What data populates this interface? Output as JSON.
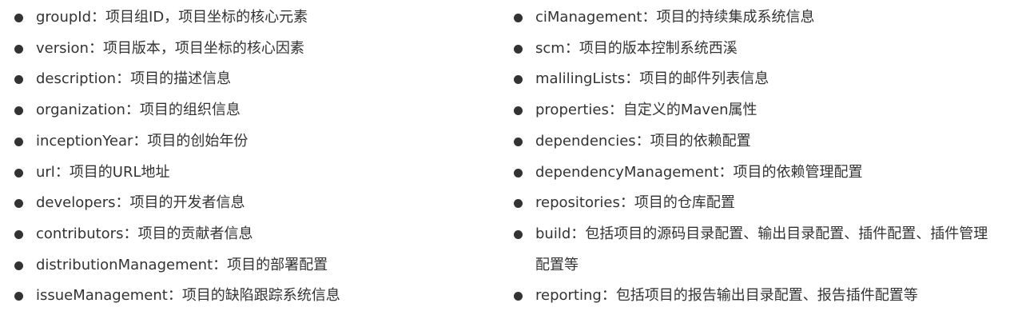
{
  "left_items": [
    {
      "key": "groupId",
      "desc": "项目组ID，项目坐标的核心元素"
    },
    {
      "key": "version",
      "desc": "项目版本，项目坐标的核心因素"
    },
    {
      "key": "description",
      "desc": "项目的描述信息"
    },
    {
      "key": "organization",
      "desc": "项目的组织信息"
    },
    {
      "key": "inceptionYear",
      "desc": "项目的创始年份"
    },
    {
      "key": "url",
      "desc": "项目的URL地址"
    },
    {
      "key": "developers",
      "desc": "项目的开发者信息"
    },
    {
      "key": "contributors",
      "desc": "项目的贡献者信息"
    },
    {
      "key": "distributionManagement",
      "desc": "项目的部署配置"
    },
    {
      "key": "issueManagement",
      "desc": "项目的缺陷跟踪系统信息"
    }
  ],
  "right_items": [
    {
      "key": "ciManagement",
      "desc": "项目的持续集成系统信息"
    },
    {
      "key": "scm",
      "desc": "项目的版本控制系统西溪"
    },
    {
      "key": "malilingLists",
      "desc": "项目的邮件列表信息"
    },
    {
      "key": "properties",
      "desc": "自定义的Maven属性"
    },
    {
      "key": "dependencies",
      "desc": "项目的依赖配置"
    },
    {
      "key": "dependencyManagement",
      "desc": "项目的依赖管理配置"
    },
    {
      "key": "repositories",
      "desc": "项目的仓库配置"
    },
    {
      "key": "build",
      "desc": "包括项目的源码目录配置、输出目录配置、插件配置、插件管理配置等"
    },
    {
      "key": "reporting",
      "desc": "包括项目的报告输出目录配置、报告插件配置等"
    }
  ],
  "separator": "："
}
